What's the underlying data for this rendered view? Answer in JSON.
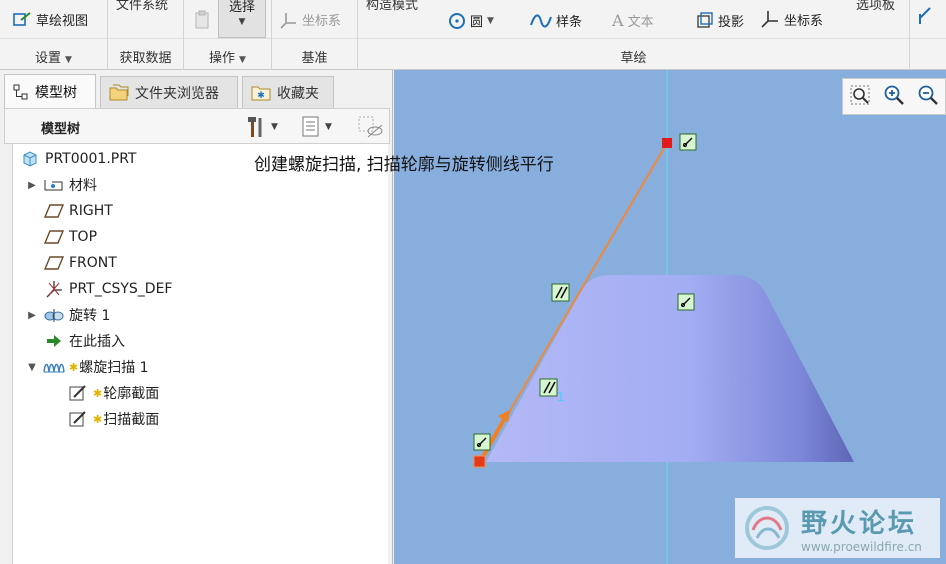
{
  "ribbon": {
    "sketch_view_label": "草绘视图",
    "file_system_label": "文件系统",
    "select_label": "选择",
    "construct_mode_label": "构造模式",
    "options_label": "选项板",
    "circle_label": "圆",
    "spline_label": "样条",
    "text_label": "文本",
    "project_label": "投影",
    "csys_label": "坐标系",
    "csys_disabled_label": "坐标系",
    "groups": {
      "settings": "设置",
      "get_data": "获取数据",
      "operations": "操作",
      "datum": "基准",
      "sketch": "草绘"
    }
  },
  "left_panel": {
    "tabs": [
      "模型树",
      "文件夹浏览器",
      "收藏夹"
    ],
    "tree_title": "模型树",
    "tree": [
      {
        "label": "PRT0001.PRT",
        "icon": "part-icon"
      },
      {
        "label": "材料",
        "icon": "material-icon"
      },
      {
        "label": "RIGHT",
        "icon": "datum-plane-icon"
      },
      {
        "label": "TOP",
        "icon": "datum-plane-icon"
      },
      {
        "label": "FRONT",
        "icon": "datum-plane-icon"
      },
      {
        "label": "PRT_CSYS_DEF",
        "icon": "csys-icon"
      },
      {
        "label": "旋转 1",
        "icon": "revolve-icon"
      },
      {
        "label": "在此插入",
        "icon": "insert-arrow-icon"
      },
      {
        "label": "螺旋扫描 1",
        "icon": "helical-sweep-icon"
      },
      {
        "label": "轮廓截面",
        "icon": "sketch-icon"
      },
      {
        "label": "扫描截面",
        "icon": "sketch-icon"
      }
    ]
  },
  "viewport": {
    "annotation": "创建螺旋扫描, 扫描轮廓与旋转侧线平行",
    "watermark_title": "野火论坛",
    "watermark_url": "www.proewildfire.cn"
  },
  "colors": {
    "viewport_bg": "#88aede",
    "solid_fill": "#a9b4f5",
    "sketch_line": "#f0883a",
    "centerline": "#5fdcf0"
  }
}
